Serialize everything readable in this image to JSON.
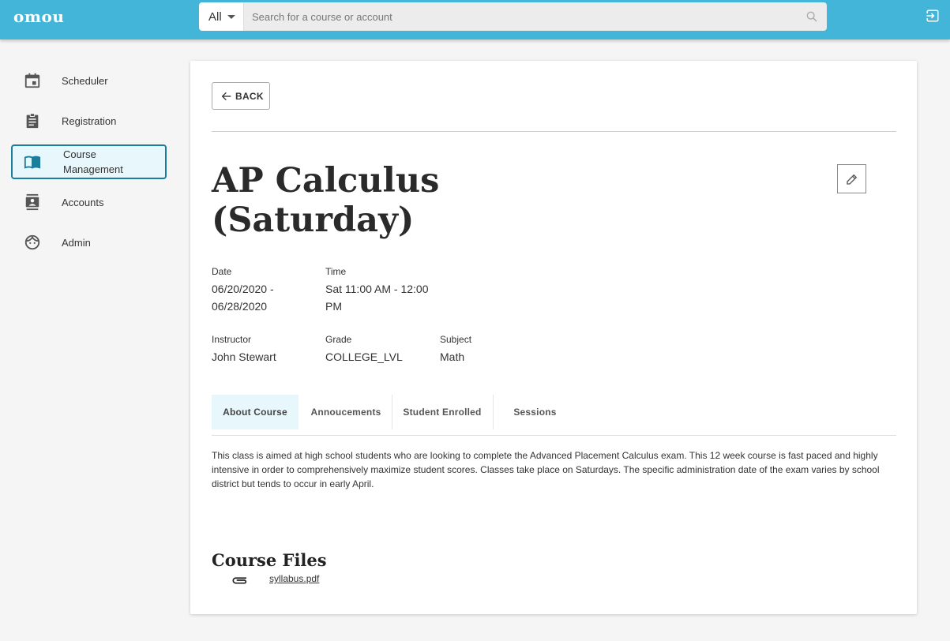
{
  "app": {
    "logo": "omou"
  },
  "search": {
    "category": "All",
    "placeholder": "Search for a course or account"
  },
  "sidebar": {
    "items": [
      {
        "label": "Scheduler",
        "icon": "calendar-icon"
      },
      {
        "label": "Registration",
        "icon": "clipboard-icon"
      },
      {
        "label": "Course Management",
        "icon": "book-icon",
        "active": true
      },
      {
        "label": "Accounts",
        "icon": "contacts-icon"
      },
      {
        "label": "Admin",
        "icon": "face-icon"
      }
    ]
  },
  "course": {
    "back_label": "BACK",
    "title": "AP Calculus (Saturday)",
    "date_label": "Date",
    "date_value": "06/20/2020 - 06/28/2020",
    "time_label": "Time",
    "time_value": "Sat 11:00 AM - 12:00 PM",
    "instructor_label": "Instructor",
    "instructor_value": "John Stewart",
    "grade_label": "Grade",
    "grade_value": "COLLEGE_LVL",
    "subject_label": "Subject",
    "subject_value": "Math",
    "tabs": [
      {
        "label": "About Course",
        "active": true
      },
      {
        "label": "Annoucements"
      },
      {
        "label": "Student Enrolled"
      },
      {
        "label": "Sessions"
      }
    ],
    "description": "This class is aimed at high school students who are looking to complete the Advanced Placement Calculus exam. This 12 week course is fast paced and highly intensive in order to comprehensively maximize student scores. Classes take place on Saturdays. The specific administration date of the exam varies by school district but tends to occur in early April.",
    "files_heading": "Course Files",
    "files": [
      {
        "name": "syllabus.pdf",
        "icon": "paperclip-icon"
      }
    ]
  },
  "colors": {
    "topbar": "#43b5d9",
    "active_border": "#1b7e9c",
    "active_bg": "#e8f7fc"
  }
}
